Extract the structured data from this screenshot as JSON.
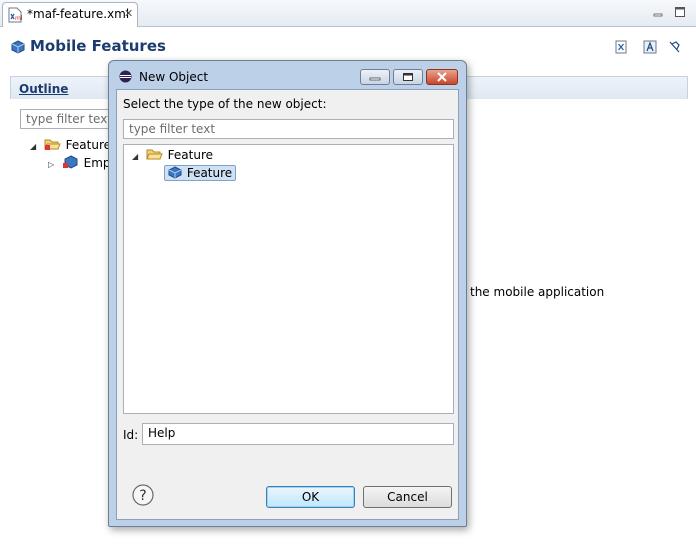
{
  "editor": {
    "tab_label": "*maf-feature.xml",
    "tab_close": "✕",
    "page_title": "Mobile Features"
  },
  "outline": {
    "title": "Outline",
    "filter_placeholder": "type filter text",
    "tree": [
      {
        "label": "Features",
        "expanded": true
      },
      {
        "label": "Empl",
        "expanded": false
      }
    ],
    "background_text": "the mobile application"
  },
  "dialog": {
    "title": "New Object",
    "prompt": "Select the type of the new object:",
    "filter_placeholder": "type filter text",
    "tree": {
      "folder_label": "Feature",
      "selected_item_label": "Feature"
    },
    "id_label": "Id:",
    "id_value": "Help",
    "help_glyph": "?",
    "ok_label": "OK",
    "cancel_label": "Cancel"
  },
  "colors": {
    "accent": "#1b3c6e",
    "dialog_frame": "#bcd0e8",
    "selection": "#cfe1f5",
    "close_button": "#c8462c"
  },
  "icons": [
    "xml-file-icon",
    "close-icon",
    "minimize-icon",
    "maximize-icon",
    "cube-icon",
    "xml-source-icon",
    "design-icon",
    "pin-icon",
    "folder-open-icon",
    "feature-cube-icon",
    "eclipse-icon",
    "help-icon"
  ]
}
